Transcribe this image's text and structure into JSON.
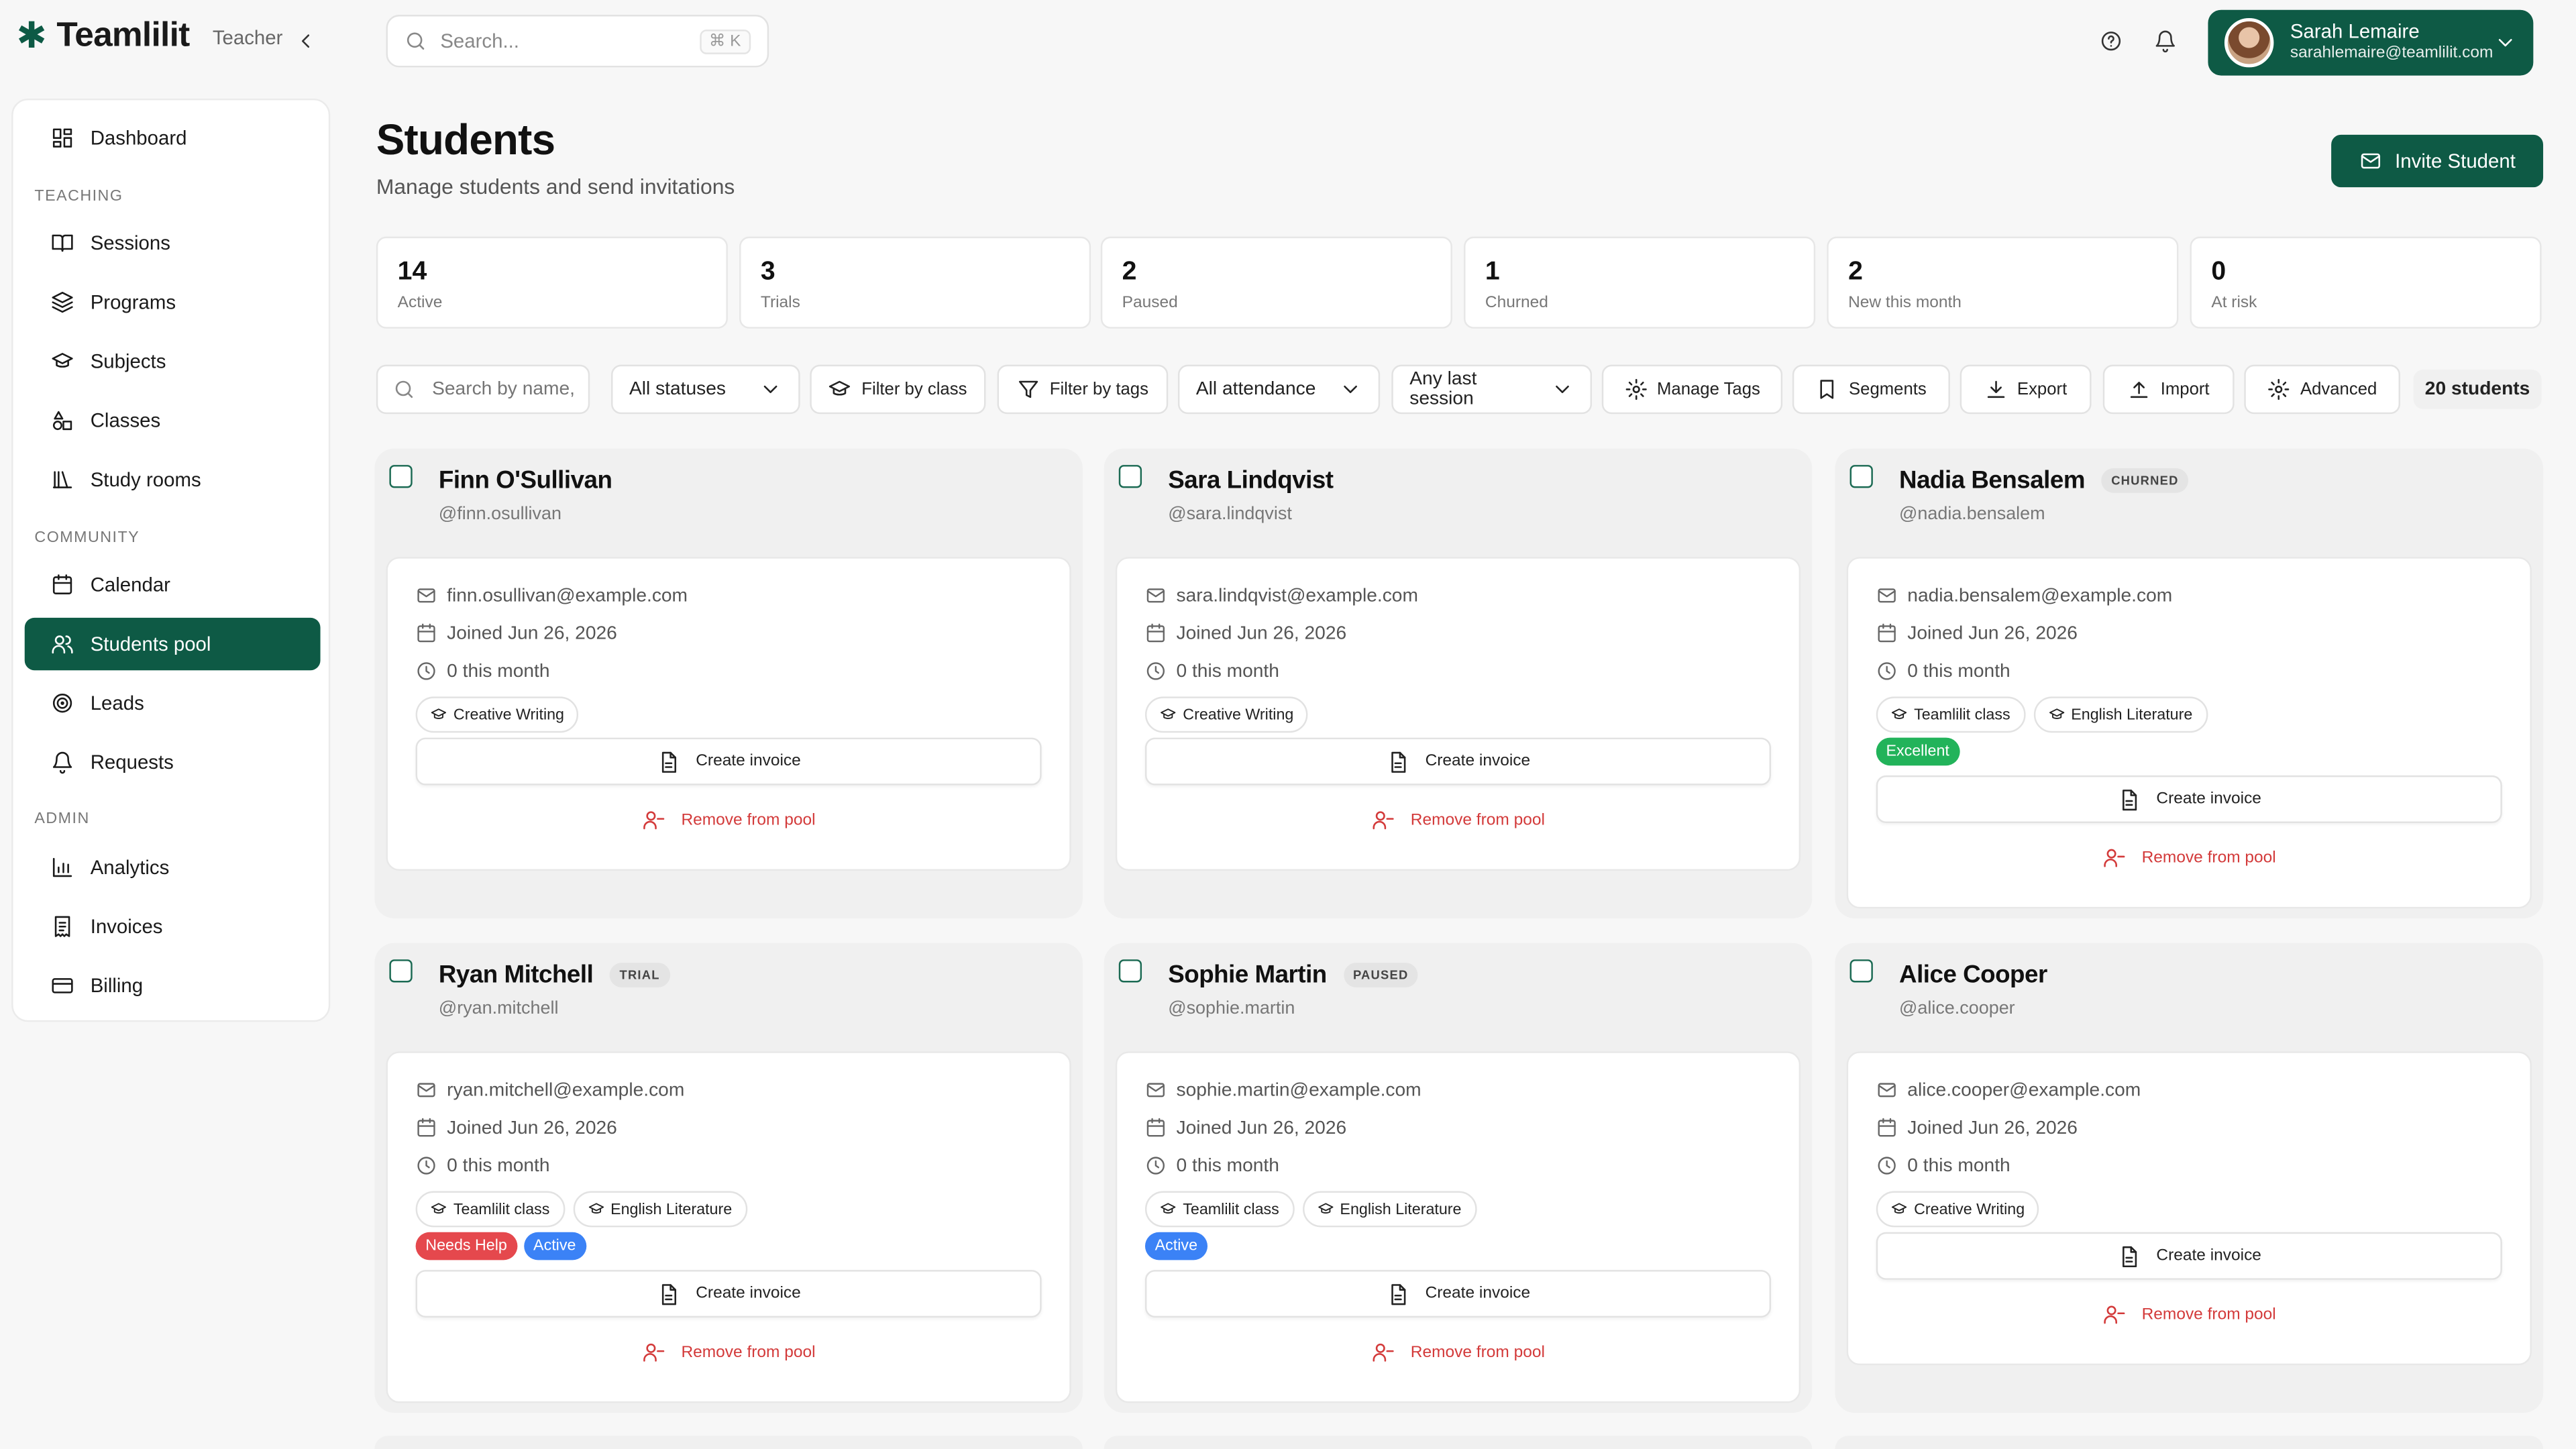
{
  "brand": {
    "logo": "✱",
    "name": "Teamlilit",
    "role": "Teacher"
  },
  "search": {
    "placeholder": "Search...",
    "shortcut": "⌘ K"
  },
  "user": {
    "name": "Sarah Lemaire",
    "email": "sarahlemaire@teamlilit.com"
  },
  "sidebar": {
    "sections": {
      "teaching": "TEACHING",
      "community": "COMMUNITY",
      "admin": "ADMIN"
    },
    "items": [
      {
        "label": "Dashboard",
        "icon": "dashboard-icon"
      },
      {
        "label": "Sessions",
        "icon": "book-icon"
      },
      {
        "label": "Programs",
        "icon": "layers-icon"
      },
      {
        "label": "Subjects",
        "icon": "graduation-cap-icon"
      },
      {
        "label": "Classes",
        "icon": "shapes-icon"
      },
      {
        "label": "Study rooms",
        "icon": "library-icon"
      },
      {
        "label": "Calendar",
        "icon": "calendar-icon"
      },
      {
        "label": "Students pool",
        "icon": "users-icon"
      },
      {
        "label": "Leads",
        "icon": "target-icon"
      },
      {
        "label": "Requests",
        "icon": "bell-icon"
      },
      {
        "label": "Analytics",
        "icon": "bar-chart-icon"
      },
      {
        "label": "Invoices",
        "icon": "receipt-icon"
      },
      {
        "label": "Billing",
        "icon": "credit-card-icon"
      }
    ]
  },
  "page": {
    "title": "Students",
    "subtitle": "Manage students and send invitations",
    "invite_label": "Invite Student"
  },
  "stats": [
    {
      "value": "14",
      "label": "Active"
    },
    {
      "value": "3",
      "label": "Trials"
    },
    {
      "value": "2",
      "label": "Paused"
    },
    {
      "value": "1",
      "label": "Churned"
    },
    {
      "value": "2",
      "label": "New this month"
    },
    {
      "value": "0",
      "label": "At risk"
    }
  ],
  "filters": {
    "search_placeholder": "Search by name,",
    "status": "All statuses",
    "by_class": "Filter by class",
    "by_tags": "Filter by tags",
    "attendance": "All attendance",
    "last_session": "Any last session",
    "manage_tags": "Manage Tags",
    "segments": "Segments",
    "export": "Export",
    "import": "Import",
    "advanced": "Advanced",
    "count": "20 students"
  },
  "card_actions": {
    "invoice": "Create invoice",
    "remove": "Remove from pool"
  },
  "students": [
    {
      "name": "Finn O'Sullivan",
      "status": "",
      "handle": "@finn.osullivan",
      "email": "finn.osullivan@example.com",
      "joined": "Joined Jun 26, 2026",
      "month": "0 this month",
      "classes": [
        "Creative Writing"
      ],
      "badges": []
    },
    {
      "name": "Sara Lindqvist",
      "status": "",
      "handle": "@sara.lindqvist",
      "email": "sara.lindqvist@example.com",
      "joined": "Joined Jun 26, 2026",
      "month": "0 this month",
      "classes": [
        "Creative Writing"
      ],
      "badges": []
    },
    {
      "name": "Nadia Bensalem",
      "status": "CHURNED",
      "handle": "@nadia.bensalem",
      "email": "nadia.bensalem@example.com",
      "joined": "Joined Jun 26, 2026",
      "month": "0 this month",
      "classes": [
        "Teamlilit class",
        "English Literature"
      ],
      "badges": [
        {
          "label": "Excellent",
          "color": "#22b35a"
        }
      ]
    },
    {
      "name": "Ryan Mitchell",
      "status": "TRIAL",
      "handle": "@ryan.mitchell",
      "email": "ryan.mitchell@example.com",
      "joined": "Joined Jun 26, 2026",
      "month": "0 this month",
      "classes": [
        "Teamlilit class",
        "English Literature"
      ],
      "badges": [
        {
          "label": "Needs Help",
          "color": "#e5484d"
        },
        {
          "label": "Active",
          "color": "#3b82f6"
        }
      ]
    },
    {
      "name": "Sophie Martin",
      "status": "PAUSED",
      "handle": "@sophie.martin",
      "email": "sophie.martin@example.com",
      "joined": "Joined Jun 26, 2026",
      "month": "0 this month",
      "classes": [
        "Teamlilit class",
        "English Literature"
      ],
      "badges": [
        {
          "label": "Active",
          "color": "#3b82f6"
        }
      ]
    },
    {
      "name": "Alice Cooper",
      "status": "",
      "handle": "@alice.cooper",
      "email": "alice.cooper@example.com",
      "joined": "Joined Jun 26, 2026",
      "month": "0 this month",
      "classes": [
        "Creative Writing"
      ],
      "badges": []
    }
  ],
  "colors": {
    "brand": "#0e5a45",
    "danger": "#d33a3a"
  }
}
